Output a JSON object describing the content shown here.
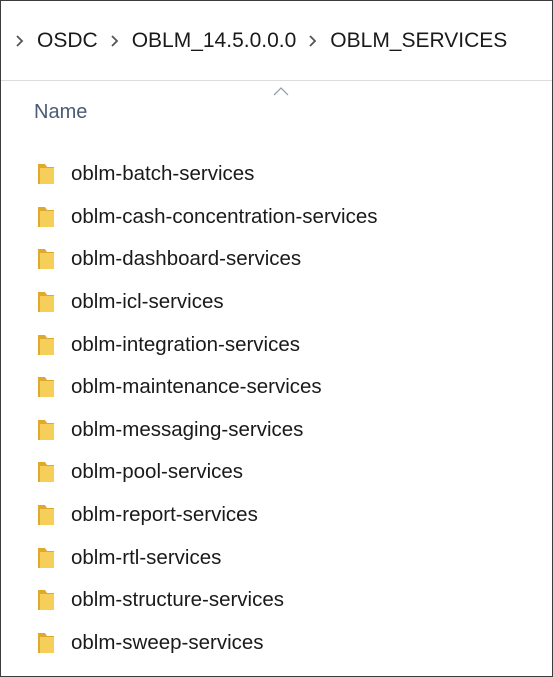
{
  "breadcrumb": {
    "items": [
      "OSDC",
      "OBLM_14.5.0.0.0",
      "OBLM_SERVICES"
    ]
  },
  "column_header": {
    "name_label": "Name",
    "sort_indicator": "sort-ascending-icon"
  },
  "files": [
    {
      "name": "oblm-batch-services",
      "icon": "folder-icon"
    },
    {
      "name": "oblm-cash-concentration-services",
      "icon": "folder-icon"
    },
    {
      "name": "oblm-dashboard-services",
      "icon": "folder-icon"
    },
    {
      "name": "oblm-icl-services",
      "icon": "folder-icon"
    },
    {
      "name": "oblm-integration-services",
      "icon": "folder-icon"
    },
    {
      "name": "oblm-maintenance-services",
      "icon": "folder-icon"
    },
    {
      "name": "oblm-messaging-services",
      "icon": "folder-icon"
    },
    {
      "name": "oblm-pool-services",
      "icon": "folder-icon"
    },
    {
      "name": "oblm-report-services",
      "icon": "folder-icon"
    },
    {
      "name": "oblm-rtl-services",
      "icon": "folder-icon"
    },
    {
      "name": "oblm-structure-services",
      "icon": "folder-icon"
    },
    {
      "name": "oblm-sweep-services",
      "icon": "folder-icon"
    }
  ],
  "colors": {
    "folder_front": "#f6cf5a",
    "folder_back": "#e0a92e",
    "header_text": "#4a5b73",
    "border": "#3c3c3c"
  }
}
